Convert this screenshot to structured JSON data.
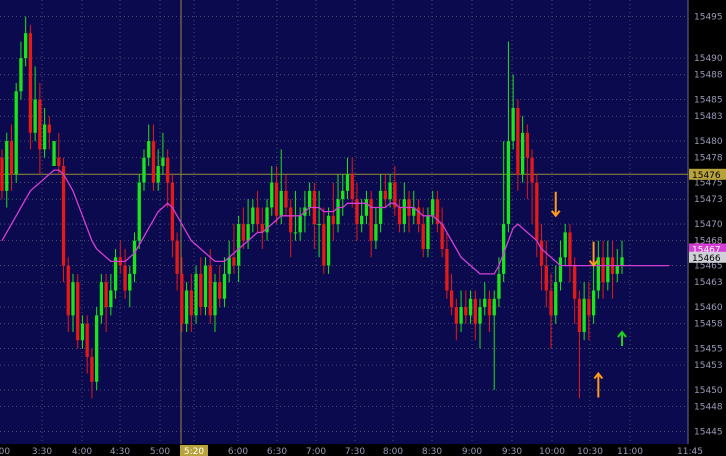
{
  "colors": {
    "background": "#0b0a4e",
    "grid": "#5a5a7a",
    "axis_bg": "#000000",
    "up": "#19e619",
    "down": "#e61919",
    "ma": "#d43ed4",
    "crosshair": "#9a8a3a",
    "arrow_orange": "#ff9a1a",
    "arrow_green": "#1ad61a"
  },
  "chart_data": {
    "type": "candlestick",
    "y_ticks": [
      "15495",
      "15490",
      "15488",
      "15485",
      "15483",
      "15480",
      "15478",
      "15475",
      "15473",
      "15470",
      "15468",
      "15465",
      "15463",
      "15460",
      "15458",
      "15455",
      "15453",
      "15450",
      "15448",
      "15445"
    ],
    "x_ticks": [
      "3:00",
      "3:30",
      "4:00",
      "4:30",
      "5:00",
      "5:20",
      "6:00",
      "6:30",
      "7:00",
      "7:30",
      "8:00",
      "8:30",
      "9:00",
      "9:30",
      "10:00",
      "10:30",
      "11:00",
      "11:45"
    ],
    "highlight_x_tick": "5:20",
    "crosshair_price": "15476",
    "last_price": "15466",
    "ma_price": "15467",
    "ylim": [
      15443.5,
      15497
    ],
    "xlim": [
      0,
      144
    ],
    "candles": [
      [
        15478,
        15474,
        15479,
        15473
      ],
      [
        15474,
        15480,
        15481,
        15472
      ],
      [
        15480,
        15476,
        15482,
        15474
      ],
      [
        15476,
        15486,
        15487,
        15475
      ],
      [
        15486,
        15490,
        15492,
        15485
      ],
      [
        15490,
        15493,
        15495,
        15489
      ],
      [
        15493,
        15481,
        15494,
        15479
      ],
      [
        15481,
        15485,
        15489,
        15480
      ],
      [
        15485,
        15479,
        15487,
        15476
      ],
      [
        15479,
        15482,
        15484,
        15478
      ],
      [
        15482,
        15481,
        15483,
        15479
      ],
      [
        15477,
        15480,
        15480,
        15478
      ],
      [
        15478,
        15477,
        15481,
        15476
      ],
      [
        15477,
        15465,
        15478,
        15463
      ],
      [
        15465,
        15459,
        15466,
        15457
      ],
      [
        15459,
        15463,
        15464,
        15457
      ],
      [
        15463,
        15456,
        15464,
        15455
      ],
      [
        15456,
        15458,
        15459,
        15455
      ],
      [
        15458,
        15454,
        15459,
        15452
      ],
      [
        15454,
        15451,
        15455,
        15449
      ],
      [
        15451,
        15459,
        15460,
        15450
      ],
      [
        15459,
        15463,
        15464,
        15458
      ],
      [
        15463,
        15460,
        15464,
        15457
      ],
      [
        15460,
        15462,
        15464,
        15459
      ],
      [
        15462,
        15466,
        15467,
        15461
      ],
      [
        15466,
        15465,
        15468,
        15464
      ],
      [
        15465,
        15462,
        15467,
        15461
      ],
      [
        15462,
        15464,
        15465,
        15460
      ],
      [
        15464,
        15468,
        15469,
        15463
      ],
      [
        15468,
        15475,
        15476,
        15467
      ],
      [
        15475,
        15478,
        15479,
        15474
      ],
      [
        15478,
        15480,
        15482,
        15477
      ],
      [
        15480,
        15475,
        15482,
        15474
      ],
      [
        15475,
        15477,
        15479,
        15474
      ],
      [
        15477,
        15478,
        15481,
        15476
      ],
      [
        15478,
        15475,
        15479,
        15472
      ],
      [
        15475,
        15468,
        15476,
        15466
      ],
      [
        15468,
        15464,
        15469,
        15462
      ],
      [
        15464,
        15458,
        15466,
        15457
      ],
      [
        15458,
        15462,
        15463,
        15457
      ],
      [
        15462,
        15459,
        15464,
        15457
      ],
      [
        15459,
        15464,
        15465,
        15458
      ],
      [
        15464,
        15460,
        15466,
        15459
      ],
      [
        15460,
        15465,
        15466,
        15459
      ],
      [
        15465,
        15459,
        15467,
        15458
      ],
      [
        15459,
        15463,
        15464,
        15457
      ],
      [
        15463,
        15461,
        15465,
        15460
      ],
      [
        15461,
        15464,
        15466,
        15460
      ],
      [
        15464,
        15466,
        15468,
        15463
      ],
      [
        15466,
        15465,
        15470,
        15464
      ],
      [
        15465,
        15470,
        15471,
        15463
      ],
      [
        15470,
        15468,
        15472,
        15467
      ],
      [
        15468,
        15470,
        15473,
        15467
      ],
      [
        15470,
        15472,
        15473,
        15469
      ],
      [
        15472,
        15470,
        15474,
        15469
      ],
      [
        15470,
        15469,
        15472,
        15467
      ],
      [
        15469,
        15472,
        15473,
        15468
      ],
      [
        15472,
        15475,
        15477,
        15471
      ],
      [
        15475,
        15471,
        15477,
        15470
      ],
      [
        15471,
        15474,
        15479,
        15470
      ],
      [
        15474,
        15472,
        15476,
        15471
      ],
      [
        15472,
        15469,
        15473,
        15466
      ],
      [
        15469,
        15469,
        15474,
        15468
      ],
      [
        15469,
        15471,
        15472,
        15468
      ],
      [
        15471,
        15472,
        15474,
        15469
      ],
      [
        15472,
        15474,
        15475,
        15471
      ],
      [
        15474,
        15470,
        15475,
        15467
      ],
      [
        15470,
        15470,
        15474,
        15466
      ],
      [
        15470,
        15465,
        15472,
        15464
      ],
      [
        15465,
        15471,
        15472,
        15464
      ],
      [
        15471,
        15470,
        15475,
        15468
      ],
      [
        15470,
        15473,
        15476,
        15469
      ],
      [
        15473,
        15474,
        15476,
        15471
      ],
      [
        15474,
        15476,
        15478,
        15473
      ],
      [
        15476,
        15473,
        15478,
        15472
      ],
      [
        15473,
        15470,
        15475,
        15468
      ],
      [
        15470,
        15471,
        15473,
        15469
      ],
      [
        15471,
        15473,
        15474,
        15470
      ],
      [
        15473,
        15468,
        15474,
        15466
      ],
      [
        15468,
        15470,
        15472,
        15467
      ],
      [
        15470,
        15474,
        15476,
        15469
      ],
      [
        15474,
        15473,
        15476,
        15472
      ],
      [
        15473,
        15475,
        15476,
        15472
      ],
      [
        15475,
        15472,
        15477,
        15471
      ],
      [
        15472,
        15470,
        15473,
        15469
      ],
      [
        15470,
        15473,
        15475,
        15469
      ],
      [
        15473,
        15471,
        15474,
        15469
      ],
      [
        15471,
        15472,
        15474,
        15470
      ],
      [
        15472,
        15470,
        15473,
        15469
      ],
      [
        15470,
        15467,
        15472,
        15466
      ],
      [
        15467,
        15471,
        15472,
        15466
      ],
      [
        15471,
        15473,
        15474,
        15470
      ],
      [
        15473,
        15470,
        15474,
        15469
      ],
      [
        15470,
        15467,
        15472,
        15466
      ],
      [
        15467,
        15462,
        15469,
        15461
      ],
      [
        15462,
        15460,
        15464,
        15459
      ],
      [
        15460,
        15458,
        15461,
        15456
      ],
      [
        15458,
        15460,
        15462,
        15457
      ],
      [
        15460,
        15459,
        15462,
        15458
      ],
      [
        15459,
        15461,
        15462,
        15458
      ],
      [
        15461,
        15458,
        15462,
        15456
      ],
      [
        15458,
        15460,
        15461,
        15455
      ],
      [
        15460,
        15461,
        15463,
        15459
      ],
      [
        15461,
        15459,
        15462,
        15457
      ],
      [
        15459,
        15461,
        15462,
        15450
      ],
      [
        15461,
        15464,
        15466,
        15460
      ],
      [
        15464,
        15470,
        15480,
        15463
      ],
      [
        15470,
        15480,
        15492,
        15469
      ],
      [
        15480,
        15484,
        15488,
        15479
      ],
      [
        15484,
        15476,
        15485,
        15474
      ],
      [
        15476,
        15481,
        15483,
        15475
      ],
      [
        15481,
        15478,
        15482,
        15473
      ],
      [
        15478,
        15475,
        15479,
        15470
      ],
      [
        15475,
        15468,
        15476,
        15466
      ],
      [
        15468,
        15465,
        15470,
        15462
      ],
      [
        15465,
        15462,
        15468,
        15460
      ],
      [
        15462,
        15459,
        15464,
        15455
      ],
      [
        15459,
        15463,
        15465,
        15458
      ],
      [
        15463,
        15466,
        15468,
        15462
      ],
      [
        15466,
        15469,
        15470,
        15465
      ],
      [
        15469,
        15465,
        15470,
        15463
      ],
      [
        15465,
        15461,
        15466,
        15458
      ],
      [
        15461,
        15457,
        15462,
        15449
      ],
      [
        15457,
        15461,
        15463,
        15456
      ],
      [
        15461,
        15459,
        15463,
        15456
      ],
      [
        15459,
        15462,
        15466,
        15458
      ],
      [
        15462,
        15466,
        15468,
        15461
      ],
      [
        15466,
        15463,
        15468,
        15461
      ],
      [
        15463,
        15466,
        15468,
        15462
      ],
      [
        15466,
        15464,
        15468,
        15461
      ],
      [
        15464,
        15465,
        15467,
        15463
      ],
      [
        15465,
        15466,
        15468,
        15464
      ]
    ],
    "ma": [
      15468,
      15469,
      15470,
      15471,
      15472,
      15473,
      15474,
      15474.5,
      15475,
      15475.5,
      15476,
      15476.5,
      15476.5,
      15476,
      15475,
      15474,
      15472.5,
      15471,
      15469.5,
      15468,
      15467,
      15466.5,
      15466,
      15465.5,
      15465.5,
      15465.5,
      15465.5,
      15466,
      15466.5,
      15467.5,
      15468.5,
      15469.5,
      15470.5,
      15471.5,
      15472,
      15472.5,
      15472,
      15471,
      15470,
      15469,
      15468,
      15467.5,
      15467,
      15466.5,
      15466,
      15465.5,
      15465.5,
      15465.5,
      15466,
      15466.5,
      15467,
      15467.5,
      15468,
      15468.5,
      15469,
      15469,
      15469.5,
      15470,
      15470.5,
      15471,
      15471,
      15471,
      15471,
      15471,
      15471.5,
      15472,
      15472,
      15472,
      15471.5,
      15471.5,
      15471.5,
      15472,
      15472,
      15472.5,
      15472.5,
      15472.5,
      15472.5,
      15472.5,
      15472,
      15472,
      15472,
      15472,
      15472.5,
      15472.5,
      15472,
      15472,
      15472,
      15472,
      15471.5,
      15471,
      15471,
      15471,
      15470.5,
      15470,
      15469,
      15468,
      15467,
      15466,
      15465.5,
      15465,
      15464.5,
      15464,
      15464,
      15464,
      15464,
      15465,
      15466.5,
      15468,
      15469.5,
      15470,
      15469.5,
      15469,
      15468.5,
      15468,
      15467,
      15466.5,
      15466,
      15465.5,
      15465,
      15465,
      15465,
      15465,
      15465,
      15465,
      15465,
      15465,
      15465,
      15465,
      15465,
      15465,
      15465,
      15465,
      15465,
      15465,
      15465,
      15465,
      15465,
      15465,
      15465,
      15465,
      15465,
      15465
    ],
    "arrows": [
      {
        "i": 117,
        "price": 15471,
        "dir": "down",
        "color": "orange"
      },
      {
        "i": 125,
        "price": 15465,
        "dir": "down",
        "color": "orange"
      },
      {
        "i": 126,
        "price": 15452,
        "dir": "up",
        "color": "orange"
      },
      {
        "i": 131,
        "price": 15457,
        "dir": "up",
        "color": "green"
      }
    ]
  }
}
